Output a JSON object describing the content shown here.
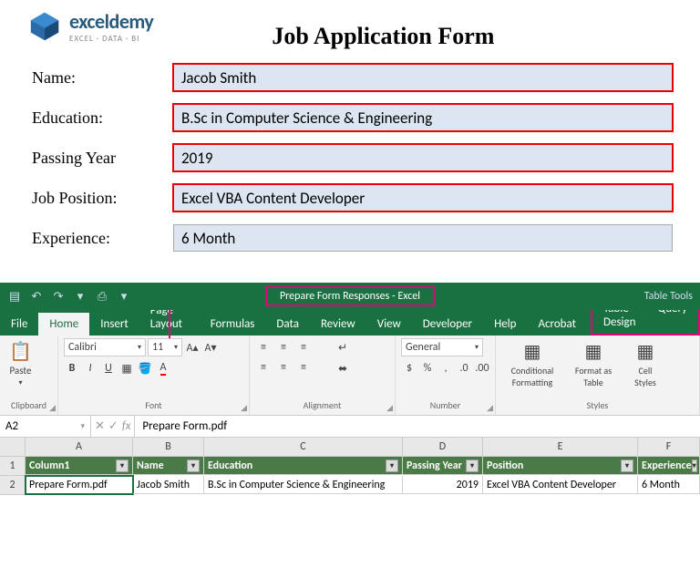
{
  "logo": {
    "brand": "exceldemy",
    "tag": "EXCEL · DATA · BI"
  },
  "form": {
    "title": "Job Application Form",
    "labels": {
      "name": "Name:",
      "education": "Education:",
      "passing": "Passing Year",
      "position": "Job Position:",
      "experience": "Experience:"
    },
    "values": {
      "name": "Jacob Smith",
      "education": "B.Sc in Computer Science & Engineering",
      "passing": "2019",
      "position": "Excel VBA Content Developer",
      "experience": "6 Month"
    }
  },
  "excel": {
    "title": "Prepare Form Responses - Excel",
    "tableTools": "Table Tools",
    "tabs": {
      "file": "File",
      "home": "Home",
      "insert": "Insert",
      "pageLayout": "Page Layout",
      "formulas": "Formulas",
      "data": "Data",
      "review": "Review",
      "view": "View",
      "developer": "Developer",
      "help": "Help",
      "acrobat": "Acrobat",
      "tableDesign": "Table Design",
      "query": "Query"
    },
    "ribbon": {
      "paste": "Paste",
      "clipboard": "Clipboard",
      "fontName": "Calibri",
      "fontSize": "11",
      "font": "Font",
      "alignment": "Alignment",
      "numberFormat": "General",
      "number": "Number",
      "condFmt": "Conditional Formatting",
      "fmtTable": "Format as Table",
      "cellStyles": "Cell Styles",
      "styles": "Styles"
    },
    "nameBox": "A2",
    "formula": "Prepare Form.pdf",
    "cols": [
      "A",
      "B",
      "C",
      "D",
      "E",
      "F"
    ],
    "headers": {
      "c1": "Column1",
      "c2": "Name",
      "c3": "Education",
      "c4": "Passing Year",
      "c5": "Position",
      "c6": "Experience"
    },
    "row2": {
      "c1": "Prepare Form.pdf",
      "c2": "Jacob Smith",
      "c3": "B.Sc in Computer Science & Engineering",
      "c4": "2019",
      "c5": "Excel VBA Content Developer",
      "c6": "6 Month"
    }
  }
}
